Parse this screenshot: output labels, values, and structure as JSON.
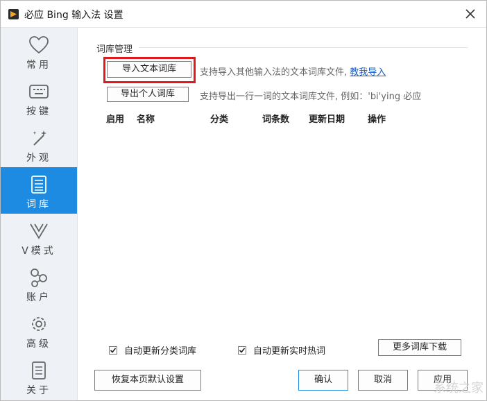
{
  "window": {
    "title": "必应 Bing 输入法 设置"
  },
  "sidebar": {
    "items": [
      {
        "label": "常用",
        "icon": "heart-icon"
      },
      {
        "label": "按键",
        "icon": "keyboard-icon"
      },
      {
        "label": "外观",
        "icon": "magic-wand-icon"
      },
      {
        "label": "词库",
        "icon": "dictionary-icon",
        "active": true
      },
      {
        "label": "V模式",
        "icon": "v-mode-icon"
      },
      {
        "label": "账户",
        "icon": "account-network-icon"
      },
      {
        "label": "高级",
        "icon": "gear-icon"
      },
      {
        "label": "关于",
        "icon": "document-icon"
      }
    ]
  },
  "dict": {
    "section_title": "词库管理",
    "import_button": "导入文本词库",
    "import_desc": "支持导入其他输入法的文本词库文件,",
    "import_help_link": "教我导入",
    "export_button": "导出个人词库",
    "export_desc": "支持导出一行一词的文本词库文件, 例如：'bi'ying 必应",
    "headers": [
      "启用",
      "名称",
      "分类",
      "词条数",
      "更新日期",
      "操作"
    ],
    "auto_update_category": "自动更新分类词库",
    "auto_update_hot": "自动更新实时热词",
    "more_download_button": "更多词库下载",
    "restore_defaults_button": "恢复本页默认设置"
  },
  "footer": {
    "ok_button": "确认",
    "cancel_button": "取消",
    "apply_button": "应用"
  },
  "watermark": "系统之家",
  "colors": {
    "active_nav": "#1e8be3",
    "highlight": "#e2191b",
    "link": "#1a5dc7"
  }
}
